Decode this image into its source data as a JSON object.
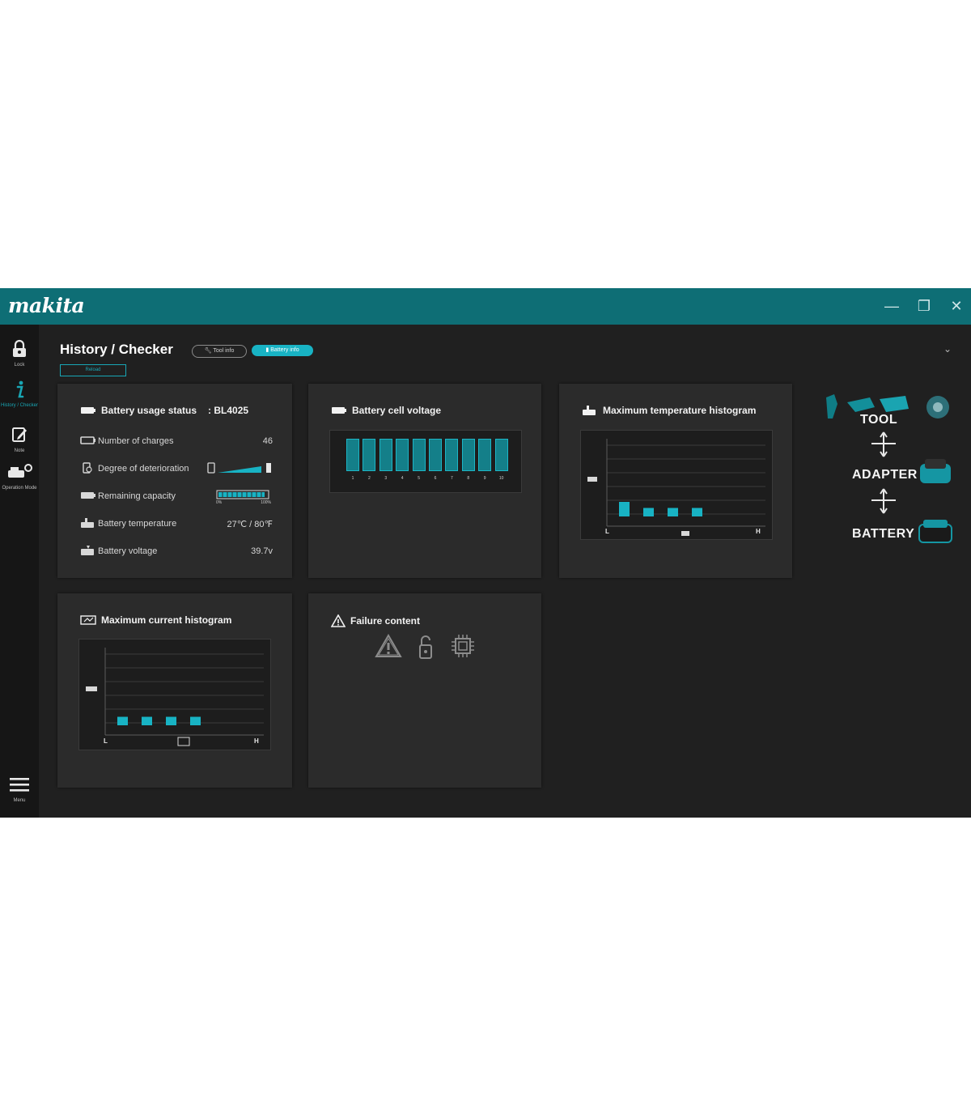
{
  "app": {
    "logo": "makita",
    "window_controls": {
      "minimize": "—",
      "restore": "❐",
      "close": "✕"
    }
  },
  "sidebar": {
    "items": [
      {
        "label": "Lock",
        "icon": "lock-icon"
      },
      {
        "label": "History / Checker",
        "icon": "info-icon",
        "active": true
      },
      {
        "label": "Note",
        "icon": "note-icon"
      },
      {
        "label": "Operation Mode",
        "icon": "operation-mode-icon"
      },
      {
        "label": "Menu",
        "icon": "menu-icon"
      }
    ]
  },
  "header": {
    "title": "History / Checker",
    "tabs": [
      {
        "label": "Tool info",
        "active": false
      },
      {
        "label": "Battery info",
        "active": true
      }
    ],
    "reload_label": "Reload"
  },
  "battery_usage": {
    "title": "Battery usage status",
    "model": ": BL4025",
    "rows": [
      {
        "label": "Number of charges",
        "value": "46",
        "icon": "battery-icon"
      },
      {
        "label": "Degree of deterioration",
        "value": "",
        "icon": "deterioration-icon",
        "level_fraction": 0.8
      },
      {
        "label": "Remaining capacity",
        "value": "",
        "icon": "capacity-icon",
        "capacity_fraction": 0.95,
        "scale_min": "0%",
        "scale_max": "100%"
      },
      {
        "label": "Battery temperature",
        "value": "27℃ / 80℉",
        "icon": "thermometer-icon"
      },
      {
        "label": "Battery voltage",
        "value": "39.7v",
        "icon": "voltage-icon"
      }
    ]
  },
  "cell_voltage": {
    "title": "Battery cell voltage",
    "cells": [
      "1",
      "2",
      "3",
      "4",
      "5",
      "6",
      "7",
      "8",
      "9",
      "10"
    ]
  },
  "temp_histogram": {
    "title": "Maximum temperature histogram",
    "axis_low": "L",
    "axis_high": "H",
    "bar_levels": [
      0.6,
      0.35,
      0.35,
      0.35
    ]
  },
  "current_histogram": {
    "title": "Maximum current histogram",
    "axis_low": "L",
    "axis_high": "H",
    "bar_levels": [
      0.35,
      0.35,
      0.35,
      0.35
    ]
  },
  "failure": {
    "title": "Failure content",
    "icons": [
      "warning-icon",
      "lock-open-icon",
      "chip-icon"
    ]
  },
  "connection_flow": {
    "items": [
      "TOOL",
      "ADAPTER",
      "BATTERY"
    ]
  },
  "colors": {
    "accent": "#18b3c4",
    "titlebar": "#0e6e75",
    "background": "#202020",
    "card": "#2b2b2b"
  }
}
